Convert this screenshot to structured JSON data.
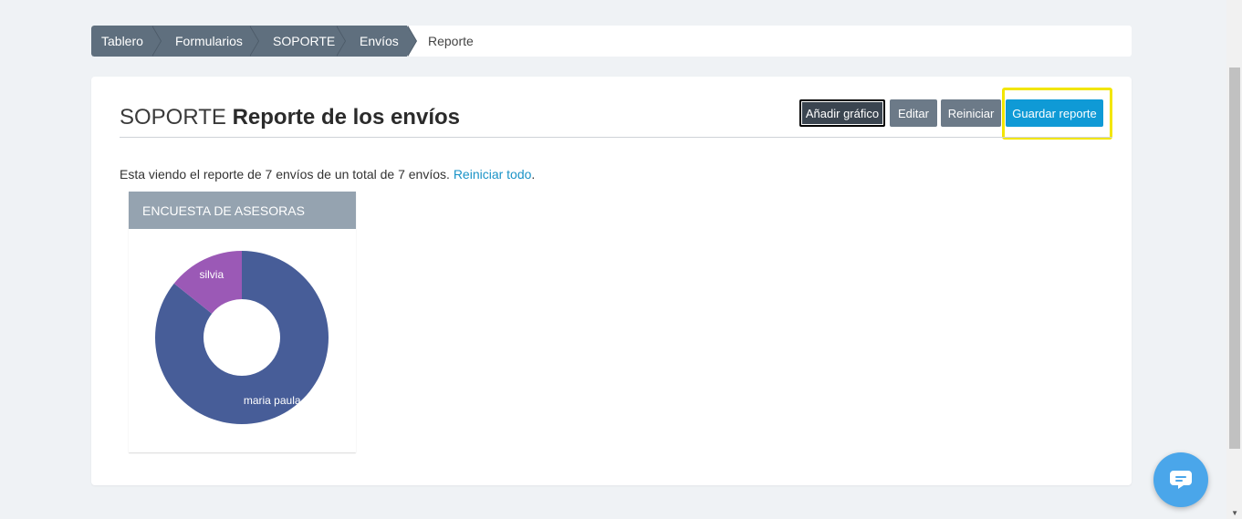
{
  "breadcrumb": {
    "items": [
      "Tablero",
      "Formularios",
      "SOPORTE",
      "Envíos"
    ],
    "current": "Reporte"
  },
  "header": {
    "title_prefix": "SOPORTE",
    "title_main": "Reporte de los envíos"
  },
  "toolbar": {
    "add_chart_label": "Añadir gráfico",
    "edit_label": "Editar",
    "reset_label": "Reiniciar",
    "save_label": "Guardar reporte"
  },
  "info": {
    "text": "Esta viendo el reporte de 7 envíos de un total de 7 envíos.",
    "reset_all_link": "Reiniciar todo"
  },
  "panel": {
    "title": "ENCUESTA DE ASESORAS"
  },
  "chart_data": {
    "type": "pie",
    "donut": true,
    "categories": [
      "maria paula",
      "silvia"
    ],
    "values": [
      6,
      1
    ],
    "colors": [
      "#475d98",
      "#9b59b6"
    ],
    "title": "ENCUESTA DE ASESORAS"
  },
  "colors": {
    "accent": "#0f9ad6",
    "breadcrumb_bg": "#5f6f7e",
    "highlight": "#f2e600",
    "chat": "#4aa6ea"
  },
  "icons": {
    "chat": "chat-bubble-icon",
    "scroll_down": "chevron-down-icon"
  }
}
